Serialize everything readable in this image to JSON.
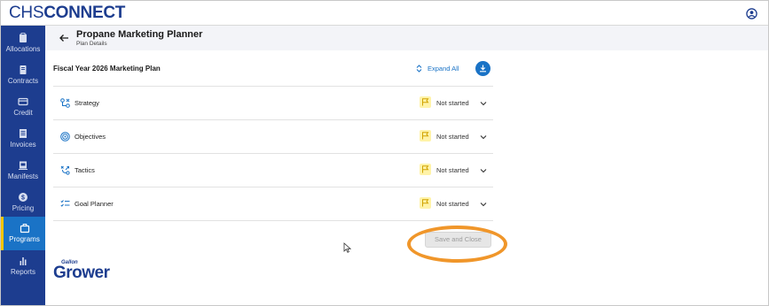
{
  "app": {
    "logo_prefix": "CHS",
    "logo_suffix": "CONNECT"
  },
  "sidebar": {
    "items": [
      {
        "label": "Allocations",
        "icon": "clipboard-icon"
      },
      {
        "label": "Contracts",
        "icon": "document-icon"
      },
      {
        "label": "Credit",
        "icon": "credit-card-icon"
      },
      {
        "label": "Invoices",
        "icon": "invoice-icon"
      },
      {
        "label": "Manifests",
        "icon": "manifest-icon"
      },
      {
        "label": "Pricing",
        "icon": "dollar-icon"
      },
      {
        "label": "Programs",
        "icon": "briefcase-icon",
        "active": true
      },
      {
        "label": "Reports",
        "icon": "bar-chart-icon"
      }
    ]
  },
  "header": {
    "title": "Propane Marketing Planner",
    "subtitle": "Plan Details"
  },
  "plan": {
    "title": "Fiscal Year 2026 Marketing Plan",
    "expand_all_label": "Expand All",
    "sections": [
      {
        "label": "Strategy",
        "status": "Not started",
        "icon": "strategy-icon"
      },
      {
        "label": "Objectives",
        "status": "Not started",
        "icon": "target-icon"
      },
      {
        "label": "Tactics",
        "status": "Not started",
        "icon": "tactics-icon"
      },
      {
        "label": "Goal Planner",
        "status": "Not started",
        "icon": "checklist-icon"
      }
    ],
    "save_label": "Save and Close"
  },
  "brand": {
    "small": "Gallon",
    "big": "Grower"
  },
  "colors": {
    "brand_blue": "#1d3d8f",
    "accent_blue": "#1a73c6",
    "status_flag": "#fff3a8",
    "highlight": "#f0962a"
  }
}
